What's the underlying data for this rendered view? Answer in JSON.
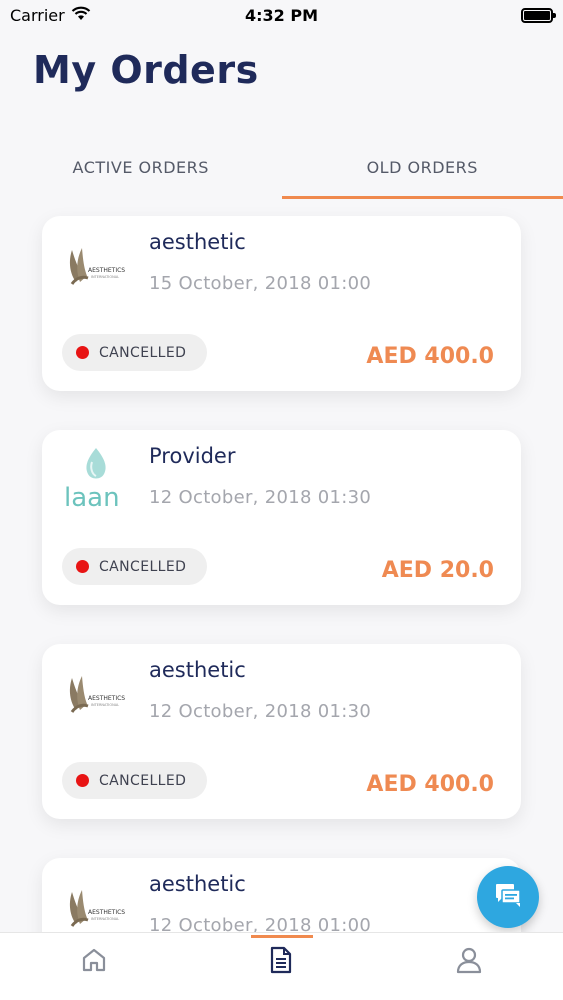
{
  "status_bar": {
    "carrier": "Carrier",
    "time": "4:32 PM"
  },
  "header": {
    "title": "My Orders"
  },
  "tabs": [
    {
      "label": "ACTIVE ORDERS",
      "active": false
    },
    {
      "label": "OLD ORDERS",
      "active": true
    }
  ],
  "orders": [
    {
      "title": "aesthetic",
      "date": "15 October, 2018 01:00",
      "status": "CANCELLED",
      "price": "AED 400.0",
      "logo_text": "AESTHETICS"
    },
    {
      "title": "Provider",
      "date": "12 October, 2018 01:30",
      "status": "CANCELLED",
      "price": "AED 20.0",
      "logo_text": "laan"
    },
    {
      "title": "aesthetic",
      "date": "12 October, 2018 01:30",
      "status": "CANCELLED",
      "price": "AED 400.0",
      "logo_text": "AESTHETICS"
    },
    {
      "title": "aesthetic",
      "date": "12 October, 2018 01:00",
      "logo_text": "AESTHETICS"
    }
  ],
  "colors": {
    "accent": "#f08a4e",
    "price": "#ef8a52",
    "fab": "#2ea7e0",
    "title": "#1f2a5a",
    "cancel_dot": "#e81414"
  },
  "icons": {
    "fab": "chat-icon",
    "nav": [
      "home-icon",
      "orders-icon",
      "profile-icon"
    ]
  }
}
